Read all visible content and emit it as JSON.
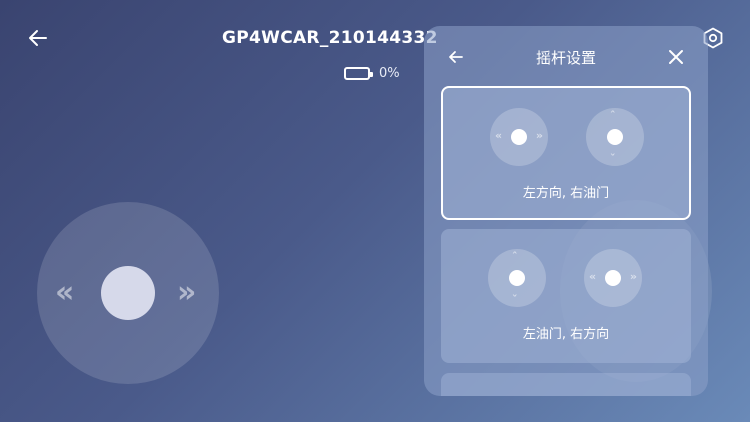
{
  "header": {
    "device_name": "GP4WCAR_210144332",
    "battery_level": "0%",
    "back_icon": "back-arrow-icon",
    "settings_icon": "hexagon-settings-icon"
  },
  "panel": {
    "title": "摇杆设置",
    "back_icon": "back-arrow-icon",
    "close_icon": "close-icon",
    "modes": [
      {
        "label": "左方向, 右油门",
        "selected": true,
        "left_stick": "horizontal",
        "right_stick": "vertical"
      },
      {
        "label": "左油门, 右方向",
        "selected": false,
        "left_stick": "vertical",
        "right_stick": "horizontal"
      }
    ]
  },
  "joystick": {
    "left_arrow": "«",
    "right_arrow": "»"
  },
  "colors": {
    "bg_start": "#3a4470",
    "bg_end": "#6a8ab8",
    "selected_border": "#ffffff"
  }
}
